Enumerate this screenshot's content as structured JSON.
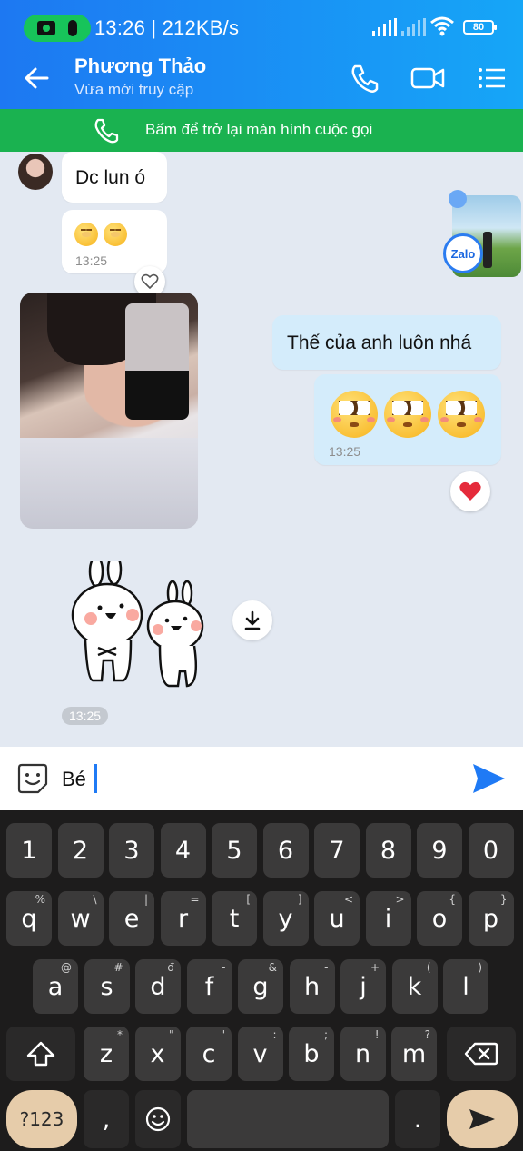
{
  "status_bar": {
    "time_speed": "13:26 | 212KB/s",
    "battery": "80"
  },
  "header": {
    "contact_name": "Phương Thảo",
    "contact_status": "Vừa mới truy cập"
  },
  "call_banner": {
    "text": "Bấm để trở lại màn hình cuộc gọi"
  },
  "messages": {
    "m1": {
      "text": "Dc lun ó"
    },
    "m2": {
      "time": "13:25"
    },
    "m3": {
      "text": "Thế của anh luôn nhá"
    },
    "m4": {
      "time": "13:25"
    },
    "sticker_time": "13:25"
  },
  "shared_badge": "Zalo",
  "input": {
    "value": "Bé"
  },
  "keyboard": {
    "row1": [
      "1",
      "2",
      "3",
      "4",
      "5",
      "6",
      "7",
      "8",
      "9",
      "0"
    ],
    "row2": [
      "q",
      "w",
      "e",
      "r",
      "t",
      "y",
      "u",
      "i",
      "o",
      "p"
    ],
    "row2_sup": [
      "%",
      "\\",
      "|",
      "=",
      "[",
      "]",
      "<",
      ">",
      "{",
      "}"
    ],
    "row3": [
      "a",
      "s",
      "d",
      "f",
      "g",
      "h",
      "j",
      "k",
      "l"
    ],
    "row3_sup": [
      "@",
      "#",
      "đ",
      "-",
      "&",
      "-",
      "+",
      "(",
      ")"
    ],
    "row4": [
      "z",
      "x",
      "c",
      "v",
      "b",
      "n",
      "m"
    ],
    "row4_sup": [
      "*",
      "\"",
      "'",
      ":",
      ";",
      "!",
      "?"
    ],
    "symbols_label": "?123",
    "comma": ",",
    "period": "."
  },
  "colors": {
    "header_start": "#1d78f2",
    "header_end": "#16a6f7",
    "call_banner": "#1ab250",
    "my_bubble": "#d4ecfb"
  }
}
